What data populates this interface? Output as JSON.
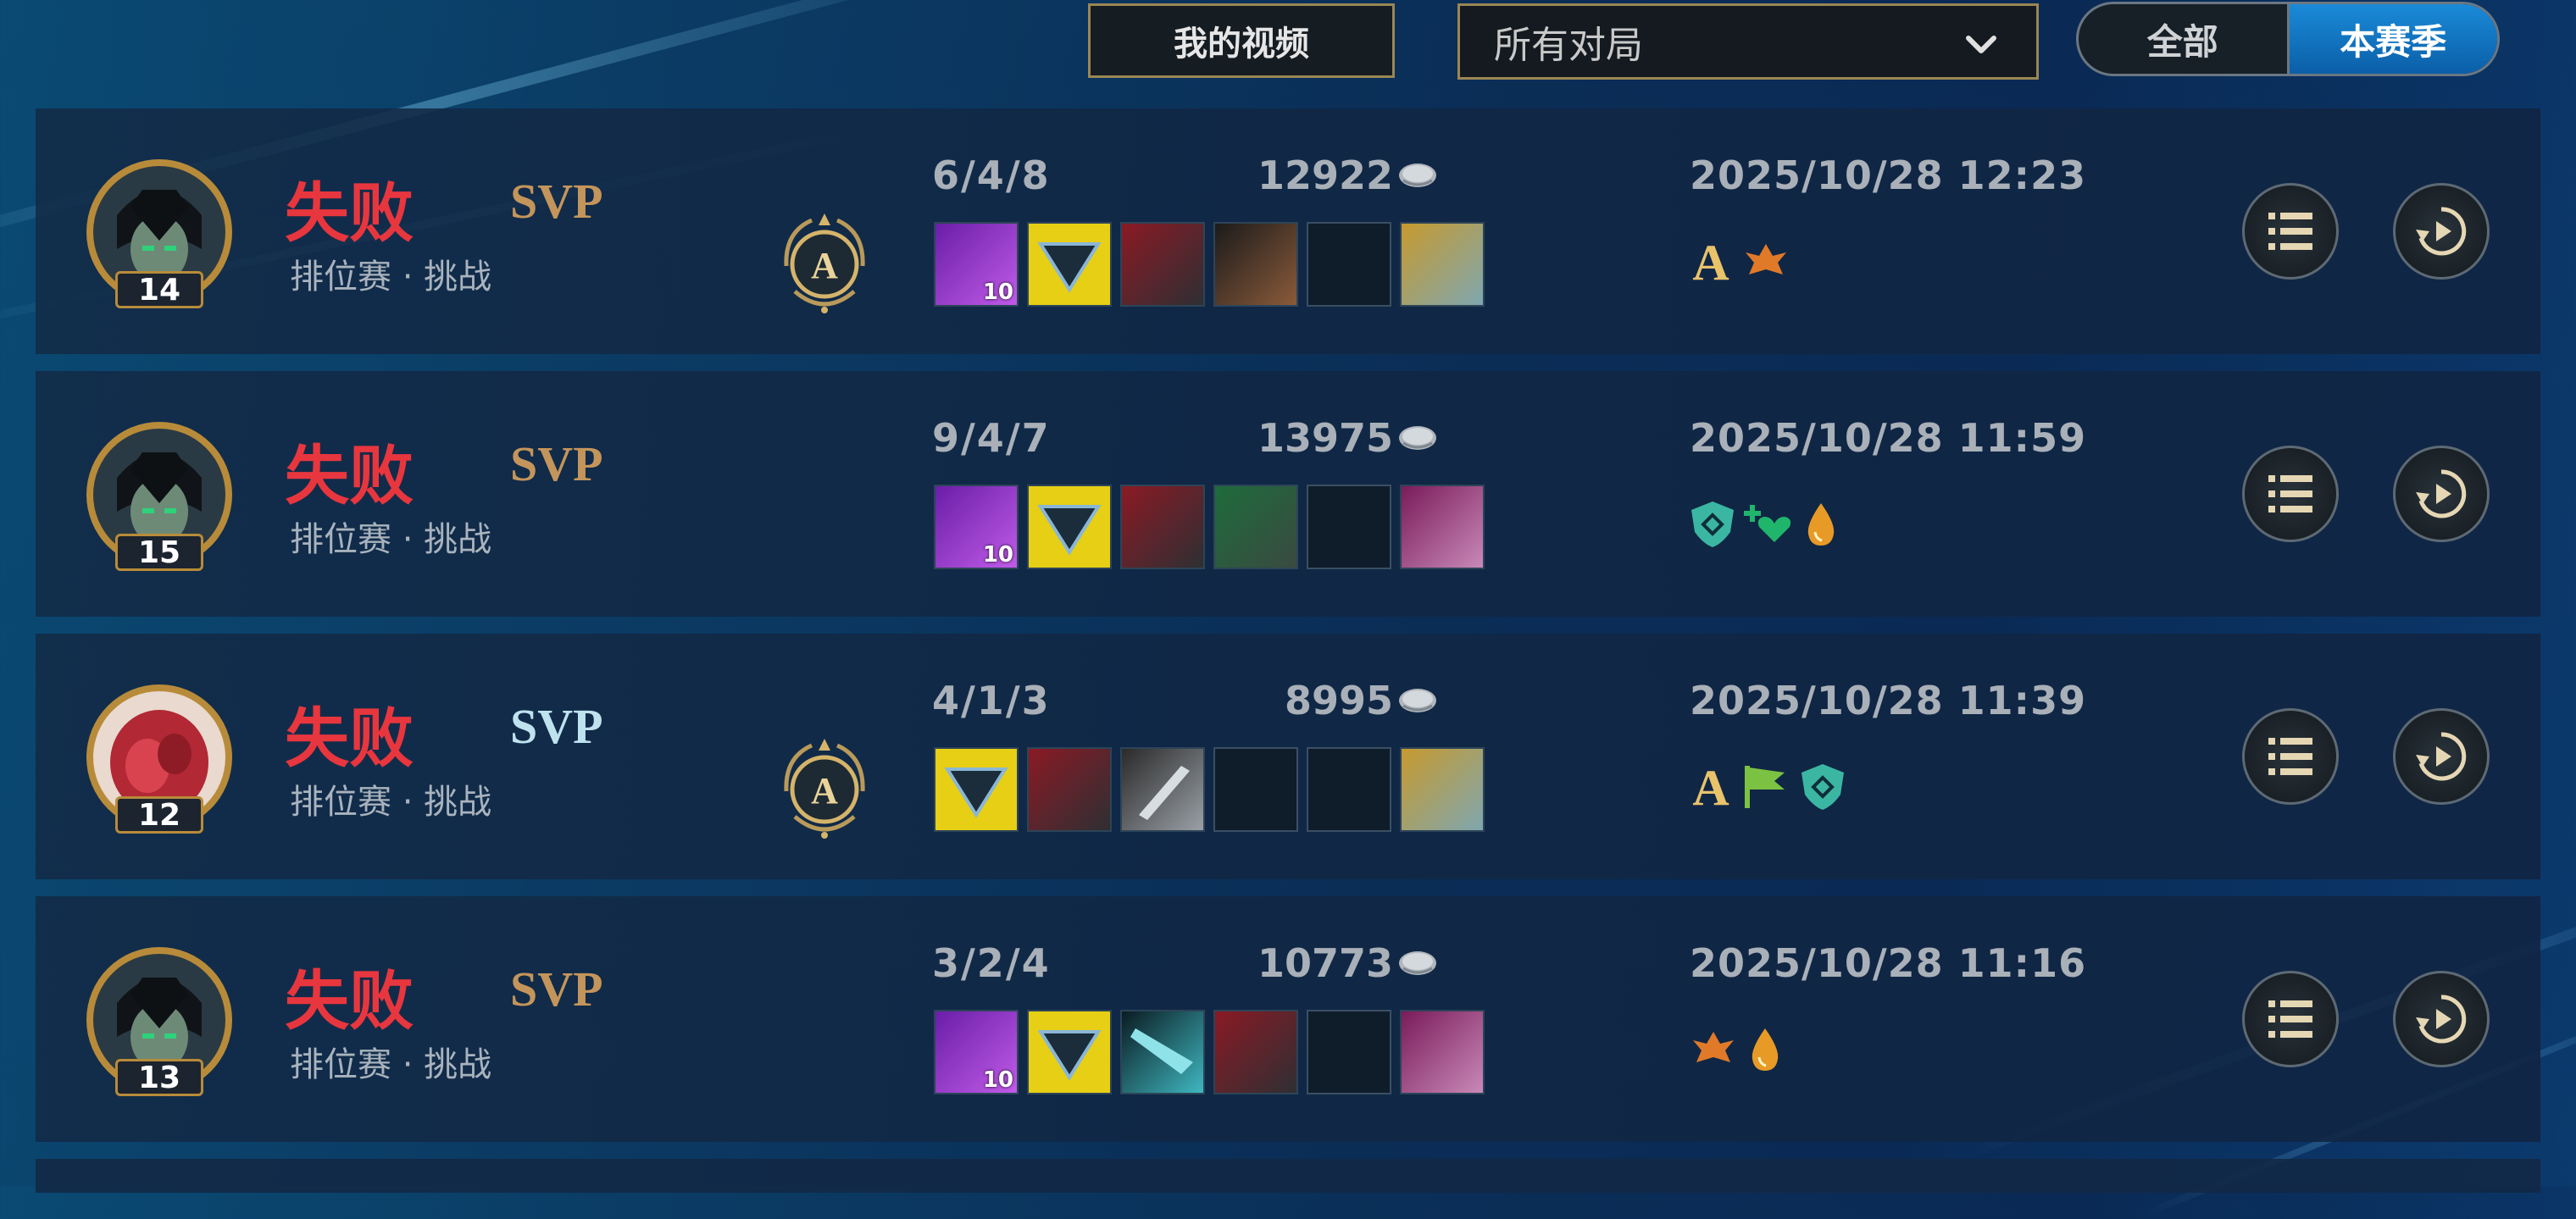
{
  "toolbar": {
    "my_videos": "我的视频",
    "filter_value": "所有对局",
    "seg_all": "全部",
    "seg_season": "本赛季"
  },
  "matches": [
    {
      "level": "14",
      "result": "失败",
      "svp": "SVP",
      "mode": "排位赛 · 挑战",
      "kda": "6/4/8",
      "gold": "12922",
      "datetime": "2025/10/28 12:23",
      "item1_count": "10"
    },
    {
      "level": "15",
      "result": "失败",
      "svp": "SVP",
      "mode": "排位赛 · 挑战",
      "kda": "9/4/7",
      "gold": "13975",
      "datetime": "2025/10/28 11:59",
      "item1_count": "10"
    },
    {
      "level": "12",
      "result": "失败",
      "svp": "SVP",
      "mode": "排位赛 · 挑战",
      "kda": "4/1/3",
      "gold": "8995",
      "datetime": "2025/10/28 11:39"
    },
    {
      "level": "13",
      "result": "失败",
      "svp": "SVP",
      "mode": "排位赛 · 挑战",
      "kda": "3/2/4",
      "gold": "10773",
      "datetime": "2025/10/28 11:16",
      "item1_count": "10"
    }
  ],
  "colors": {
    "defeat": "#e8363e",
    "svp_gold": "#c4955b",
    "svp_silver": "#bfe2ef",
    "accent_blue": "#1a8ad8"
  }
}
